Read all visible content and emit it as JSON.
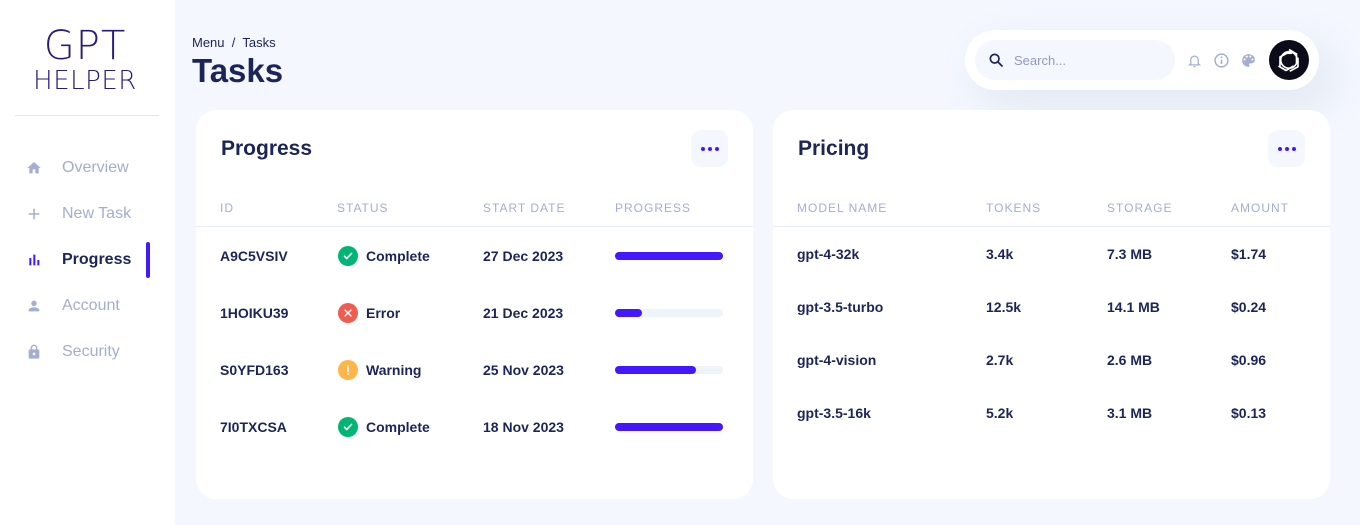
{
  "logo": {
    "line1": "GPT",
    "line2": "HELPER"
  },
  "sidebar": {
    "items": [
      {
        "label": "Overview",
        "icon": "home-icon",
        "active": false
      },
      {
        "label": "New Task",
        "icon": "plus-icon",
        "active": false
      },
      {
        "label": "Progress",
        "icon": "bar-chart-icon",
        "active": true
      },
      {
        "label": "Account",
        "icon": "person-icon",
        "active": false
      },
      {
        "label": "Security",
        "icon": "lock-icon",
        "active": false
      }
    ]
  },
  "header": {
    "breadcrumb": "Menu  /  Tasks",
    "title": "Tasks"
  },
  "topbar": {
    "search_placeholder": "Search...",
    "icons": [
      "bell-icon",
      "info-icon",
      "palette-icon"
    ],
    "avatar": "openai-logo-icon"
  },
  "progress": {
    "title": "Progress",
    "columns": [
      "ID",
      "STATUS",
      "START DATE",
      "PROGRESS"
    ],
    "rows": [
      {
        "id": "A9C5VSIV",
        "status": "Complete",
        "status_type": "success",
        "start_date": "27 Dec 2023",
        "progress": 1.0
      },
      {
        "id": "1HOIKU39",
        "status": "Error",
        "status_type": "error",
        "start_date": "21 Dec 2023",
        "progress": 0.25
      },
      {
        "id": "S0YFD163",
        "status": "Warning",
        "status_type": "warning",
        "start_date": "25 Nov 2023",
        "progress": 0.75
      },
      {
        "id": "7I0TXCSA",
        "status": "Complete",
        "status_type": "success",
        "start_date": "18 Nov 2023",
        "progress": 1.0
      }
    ]
  },
  "pricing": {
    "title": "Pricing",
    "columns": [
      "MODEL NAME",
      "TOKENS",
      "STORAGE",
      "AMOUNT"
    ],
    "rows": [
      {
        "model": "gpt-4-32k",
        "tokens": "3.4k",
        "storage": "7.3 MB",
        "amount": "$1.74"
      },
      {
        "model": "gpt-3.5-turbo",
        "tokens": "12.5k",
        "storage": "14.1 MB",
        "amount": "$0.24"
      },
      {
        "model": "gpt-4-vision",
        "tokens": "2.7k",
        "storage": "2.6 MB",
        "amount": "$0.96"
      },
      {
        "model": "gpt-3.5-16k",
        "tokens": "5.2k",
        "storage": "3.1 MB",
        "amount": "$0.13"
      }
    ]
  },
  "colors": {
    "accent": "#4318ff",
    "text": "#1b2559",
    "muted": "#a3aed0",
    "success": "#01b574",
    "error": "#ee5d50",
    "warning": "#ffb547",
    "background": "#f4f7fe"
  }
}
